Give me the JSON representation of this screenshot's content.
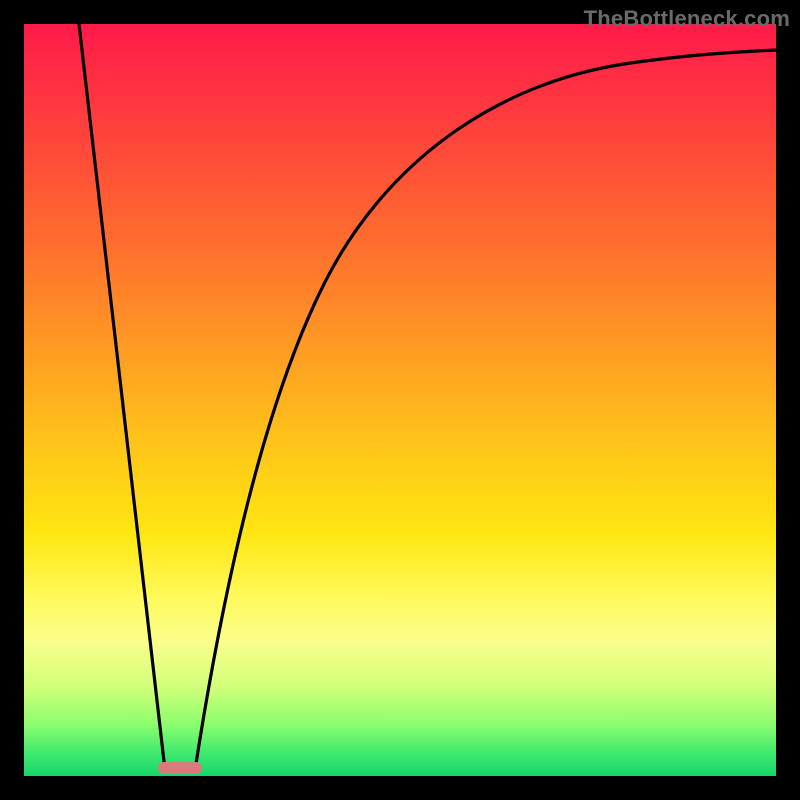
{
  "watermark": "TheBottleneck.com",
  "colors": {
    "frame": "#000000",
    "curve": "#000000",
    "marker": "#d97b7a",
    "gradient_top": "#ff1a4a",
    "gradient_bottom": "#17d66a",
    "watermark": "#6a6a6a"
  },
  "chart_data": {
    "type": "line",
    "title": "",
    "xlabel": "",
    "ylabel": "",
    "xlim": [
      0,
      100
    ],
    "ylim": [
      0,
      100
    ],
    "grid": false,
    "legend": false,
    "annotations": [
      "TheBottleneck.com"
    ],
    "background": "vertical-gradient-red-to-green",
    "optimum_marker": {
      "x": 20,
      "y": 0,
      "shape": "pill",
      "color": "#d97b7a"
    },
    "series": [
      {
        "name": "left-branch",
        "x": [
          7,
          9,
          11,
          13,
          15,
          17,
          19
        ],
        "y": [
          100,
          82,
          65,
          48,
          32,
          15,
          0
        ]
      },
      {
        "name": "right-branch",
        "x": [
          23,
          27,
          32,
          38,
          45,
          55,
          65,
          78,
          90,
          100
        ],
        "y": [
          0,
          20,
          40,
          55,
          68,
          80,
          88,
          93,
          96,
          97
        ]
      }
    ]
  }
}
